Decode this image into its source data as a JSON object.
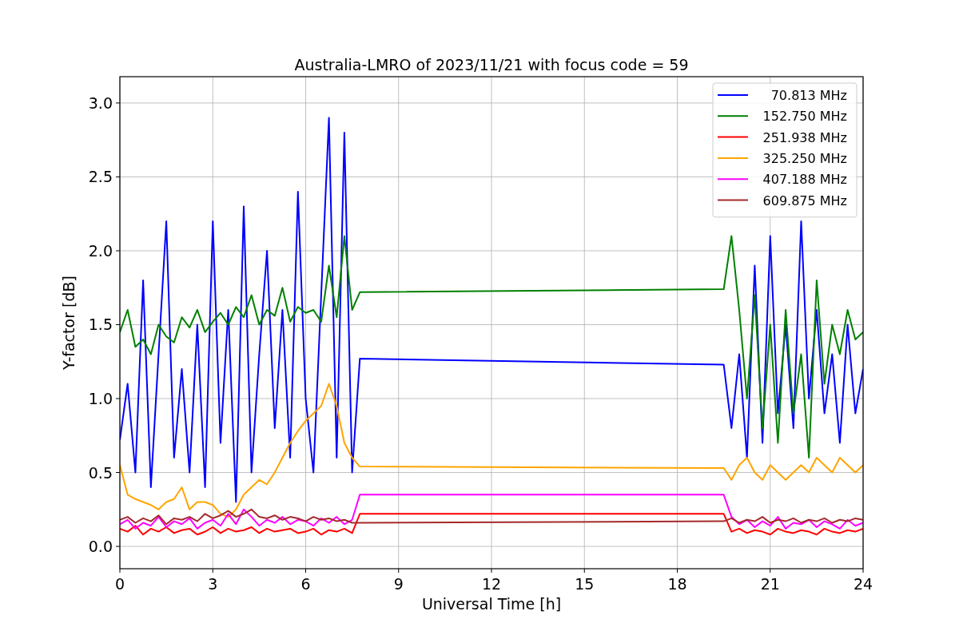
{
  "chart_data": {
    "type": "line",
    "title": "Australia-LMRO of 2023/11/21 with focus code = 59",
    "xlabel": "Universal Time [h]",
    "ylabel": "Y-factor [dB]",
    "x": [
      0,
      0.25,
      0.5,
      0.75,
      1,
      1.25,
      1.5,
      1.75,
      2,
      2.25,
      2.5,
      2.75,
      3,
      3.25,
      3.5,
      3.75,
      4,
      4.25,
      4.5,
      4.75,
      5,
      5.25,
      5.5,
      5.75,
      6,
      6.25,
      6.5,
      6.75,
      7,
      7.25,
      7.5,
      7.75,
      19.5,
      19.75,
      20,
      20.25,
      20.5,
      20.75,
      21,
      21.25,
      21.5,
      21.75,
      22,
      22.25,
      22.5,
      22.75,
      23,
      23.25,
      23.5,
      23.75,
      24
    ],
    "series": [
      {
        "name": "70.813 MHz",
        "color": "#0000ff",
        "values": [
          0.72,
          1.1,
          0.5,
          1.8,
          0.4,
          1.3,
          2.2,
          0.6,
          1.2,
          0.5,
          1.5,
          0.4,
          2.2,
          0.7,
          1.6,
          0.3,
          2.3,
          0.5,
          1.3,
          2.0,
          0.8,
          1.6,
          0.6,
          2.4,
          1.0,
          0.5,
          1.7,
          2.9,
          0.6,
          2.8,
          0.5,
          1.27,
          1.23,
          0.8,
          1.3,
          0.6,
          1.9,
          0.7,
          2.1,
          0.9,
          1.5,
          0.8,
          2.2,
          1.0,
          1.6,
          0.9,
          1.3,
          0.7,
          1.5,
          0.9,
          1.2
        ]
      },
      {
        "name": "152.750 MHz",
        "color": "#008000",
        "values": [
          1.45,
          1.6,
          1.35,
          1.4,
          1.3,
          1.5,
          1.42,
          1.38,
          1.55,
          1.48,
          1.6,
          1.45,
          1.52,
          1.58,
          1.5,
          1.62,
          1.55,
          1.7,
          1.5,
          1.6,
          1.56,
          1.75,
          1.52,
          1.62,
          1.58,
          1.6,
          1.52,
          1.9,
          1.55,
          2.1,
          1.6,
          1.72,
          1.74,
          2.1,
          1.6,
          1.0,
          1.7,
          0.8,
          1.5,
          0.7,
          1.6,
          0.9,
          1.3,
          0.6,
          1.8,
          1.1,
          1.5,
          1.3,
          1.6,
          1.4,
          1.45
        ]
      },
      {
        "name": "251.938 MHz",
        "color": "#ff0000",
        "values": [
          0.12,
          0.1,
          0.14,
          0.08,
          0.12,
          0.1,
          0.13,
          0.09,
          0.11,
          0.12,
          0.08,
          0.1,
          0.13,
          0.09,
          0.12,
          0.1,
          0.11,
          0.13,
          0.09,
          0.12,
          0.1,
          0.11,
          0.12,
          0.09,
          0.1,
          0.12,
          0.08,
          0.11,
          0.1,
          0.12,
          0.09,
          0.22,
          0.22,
          0.1,
          0.12,
          0.09,
          0.11,
          0.1,
          0.08,
          0.12,
          0.1,
          0.09,
          0.11,
          0.1,
          0.08,
          0.12,
          0.1,
          0.09,
          0.11,
          0.1,
          0.12
        ]
      },
      {
        "name": "325.250 MHz",
        "color": "#ffa500",
        "values": [
          0.55,
          0.35,
          0.32,
          0.3,
          0.28,
          0.25,
          0.3,
          0.32,
          0.4,
          0.25,
          0.3,
          0.3,
          0.28,
          0.22,
          0.2,
          0.25,
          0.35,
          0.4,
          0.45,
          0.42,
          0.5,
          0.6,
          0.7,
          0.78,
          0.85,
          0.9,
          0.95,
          1.1,
          0.95,
          0.7,
          0.6,
          0.54,
          0.53,
          0.45,
          0.55,
          0.6,
          0.5,
          0.45,
          0.55,
          0.5,
          0.45,
          0.5,
          0.55,
          0.5,
          0.6,
          0.55,
          0.5,
          0.6,
          0.55,
          0.5,
          0.55
        ]
      },
      {
        "name": "407.188 MHz",
        "color": "#ff00ff",
        "values": [
          0.15,
          0.18,
          0.12,
          0.16,
          0.14,
          0.2,
          0.13,
          0.17,
          0.15,
          0.19,
          0.12,
          0.16,
          0.18,
          0.14,
          0.22,
          0.15,
          0.25,
          0.2,
          0.14,
          0.18,
          0.16,
          0.2,
          0.15,
          0.18,
          0.17,
          0.14,
          0.19,
          0.16,
          0.2,
          0.15,
          0.18,
          0.35,
          0.35,
          0.2,
          0.15,
          0.18,
          0.13,
          0.17,
          0.14,
          0.2,
          0.12,
          0.16,
          0.15,
          0.18,
          0.13,
          0.17,
          0.15,
          0.12,
          0.18,
          0.14,
          0.16
        ]
      },
      {
        "name": "609.875 MHz",
        "color": "#a52a2a",
        "values": [
          0.18,
          0.2,
          0.16,
          0.19,
          0.17,
          0.21,
          0.15,
          0.19,
          0.18,
          0.2,
          0.17,
          0.22,
          0.19,
          0.21,
          0.24,
          0.2,
          0.22,
          0.25,
          0.2,
          0.19,
          0.21,
          0.18,
          0.2,
          0.19,
          0.17,
          0.2,
          0.18,
          0.19,
          0.17,
          0.18,
          0.16,
          0.16,
          0.17,
          0.19,
          0.16,
          0.18,
          0.17,
          0.2,
          0.16,
          0.18,
          0.17,
          0.19,
          0.16,
          0.18,
          0.17,
          0.19,
          0.16,
          0.18,
          0.17,
          0.19,
          0.18
        ]
      }
    ],
    "grid": true,
    "legend": true,
    "xlim": [
      0,
      24
    ],
    "ylim": [
      -0.151,
      3.178
    ],
    "xticks": [
      0,
      3,
      6,
      9,
      12,
      15,
      18,
      21,
      24
    ],
    "yticks": [
      {
        "value": 0,
        "label": "0.0"
      },
      {
        "value": 0.5,
        "label": "0.5"
      },
      {
        "value": 1,
        "label": "1.0"
      },
      {
        "value": 1.5,
        "label": "1.5"
      },
      {
        "value": 2,
        "label": "2.0"
      },
      {
        "value": 2.5,
        "label": "2.5"
      },
      {
        "value": 3,
        "label": "3.0"
      }
    ]
  }
}
